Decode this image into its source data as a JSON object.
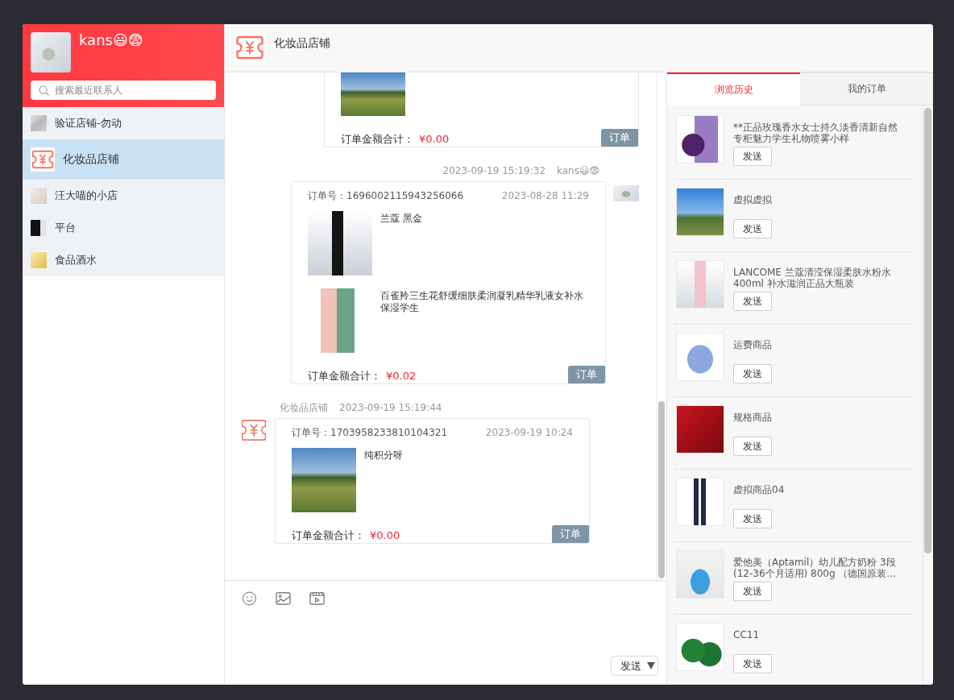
{
  "user": {
    "name": "kans😃😨"
  },
  "search": {
    "placeholder": "搜索最近联系人"
  },
  "contacts": [
    {
      "name": "验证店铺-勿动",
      "kind": "photo",
      "selected": false
    },
    {
      "name": "化妆品店铺",
      "kind": "logo",
      "selected": true
    },
    {
      "name": "汪大喵的小店",
      "kind": "photo",
      "selected": false
    },
    {
      "name": "平台",
      "kind": "photo",
      "selected": false
    },
    {
      "name": "食品酒水",
      "kind": "photo",
      "selected": false
    }
  ],
  "chat": {
    "title": "化妆品店铺",
    "messages": [
      {
        "kind": "sent",
        "order": {
          "items": [
            {
              "cut_off": true
            }
          ],
          "total_label": "订单金额合计：",
          "total": "¥0.00",
          "tag": "订单"
        }
      },
      {
        "kind": "sent",
        "time": "2023-09-19 15:19:32",
        "sender": "kans😃😨",
        "order": {
          "number": "订单号：1696002115943256066",
          "date": "2023-08-28 11:29",
          "items": [
            {
              "name": "兰蔻 黑金",
              "cut_off": false
            },
            {
              "name": "百雀羚三生花舒缓细肤柔润凝乳精华乳液女补水保湿学生",
              "cut_off": false
            }
          ],
          "total_label": "订单金额合计：",
          "total": "¥0.02",
          "tag": "订单"
        }
      },
      {
        "kind": "received",
        "sender": "化妆品店铺",
        "time": "2023-09-19 15:19:44",
        "order": {
          "number": "订单号：1703958233810104321",
          "date": "2023-09-19 10:24",
          "items": [
            {
              "name": "纯积分呀",
              "cut_off": false
            }
          ],
          "total_label": "订单金额合计：",
          "total": "¥0.00",
          "tag": "订单"
        }
      }
    ],
    "send": "发送"
  },
  "panel": {
    "tabs": [
      {
        "label": "浏览历史",
        "selected": true
      },
      {
        "label": "我的订单",
        "selected": false
      }
    ],
    "history": [
      {
        "name": "**正品玫瑰香水女士持久淡香清新自然专柜魅力学生礼物喷雾小样",
        "button": "发送"
      },
      {
        "name": "虚拟虚拟",
        "button": "发送"
      },
      {
        "name": "LANCOME 兰蔻清滢保湿柔肤水粉水400ml 补水滋润正品大瓶装",
        "button": "发送"
      },
      {
        "name": "运费商品",
        "button": "发送"
      },
      {
        "name": "规格商品",
        "button": "发送"
      },
      {
        "name": "虚拟商品04",
        "button": "发送"
      },
      {
        "name": "爱他美（Aptamil）幼儿配方奶粉 3段(12-36个月适用) 800g （德国原装...",
        "button": "发送"
      },
      {
        "name": "CC11",
        "button": "发送"
      }
    ]
  }
}
